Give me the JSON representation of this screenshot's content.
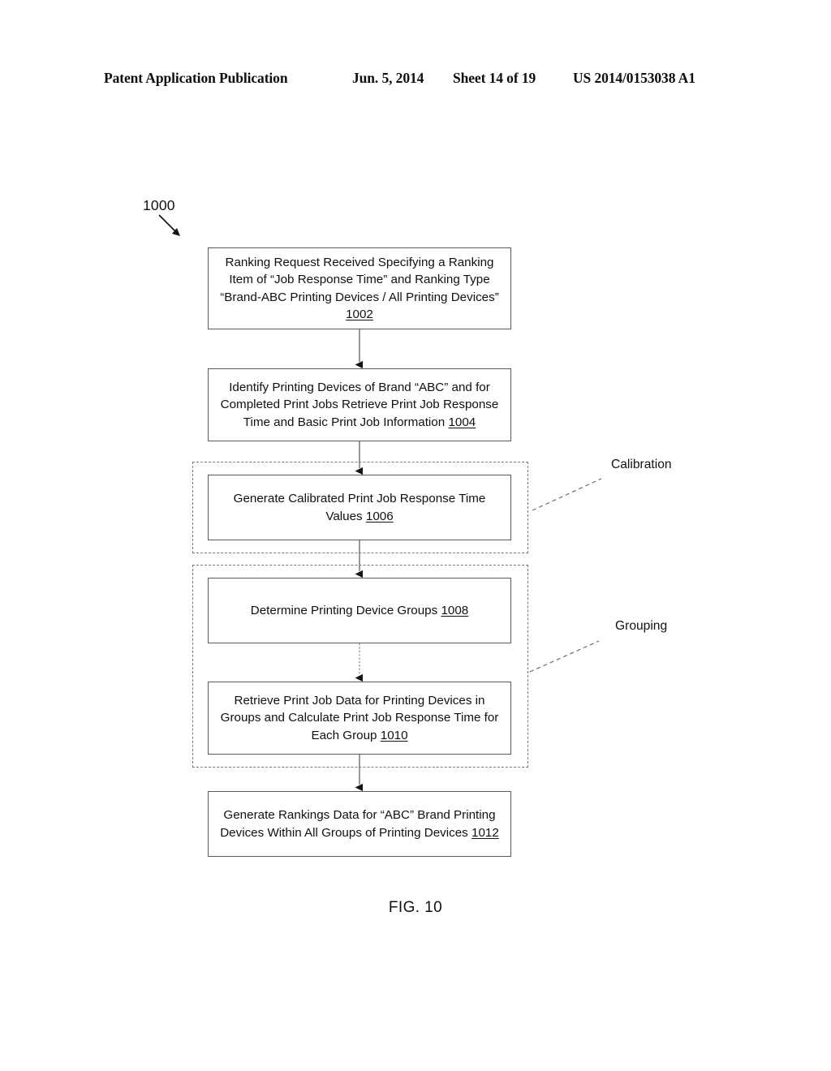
{
  "header": {
    "publication": "Patent Application Publication",
    "date": "Jun. 5, 2014",
    "sheet": "Sheet 14 of 19",
    "patent_number": "US 2014/0153038 A1"
  },
  "figure": {
    "flow_reference": "1000",
    "caption": "FIG. 10",
    "boxes": [
      {
        "id": "1002",
        "text": "Ranking Request Received Specifying a Ranking Item of “Job Response Time” and Ranking Type “Brand-ABC Printing Devices / All Printing Devices”",
        "ref": "1002"
      },
      {
        "id": "1004",
        "text": "Identify Printing Devices of Brand “ABC” and for Completed Print Jobs Retrieve Print Job Response Time and Basic Print Job Information",
        "ref": "1004"
      },
      {
        "id": "1006",
        "text": "Generate Calibrated Print Job Response Time Values",
        "ref": "1006"
      },
      {
        "id": "1008",
        "text": "Determine Printing Device Groups",
        "ref": "1008"
      },
      {
        "id": "1010",
        "text": "Retrieve Print Job Data for Printing Devices in Groups and Calculate Print Job Response Time for Each Group",
        "ref": "1010"
      },
      {
        "id": "1012",
        "text": "Generate Rankings Data for “ABC” Brand Printing Devices Within All Groups of Printing Devices",
        "ref": "1012"
      }
    ],
    "regions": [
      {
        "id": "calibration",
        "label": "Calibration"
      },
      {
        "id": "grouping",
        "label": "Grouping"
      }
    ]
  }
}
